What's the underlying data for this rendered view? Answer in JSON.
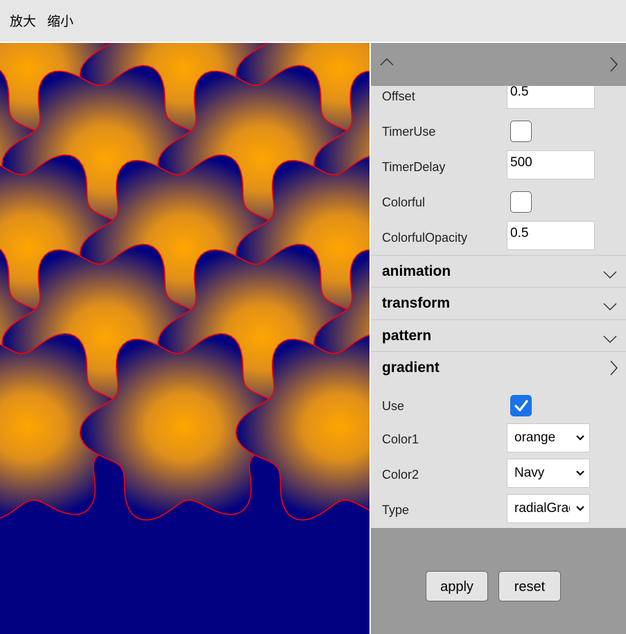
{
  "toolbar": {
    "zoom_in_label": "放大",
    "zoom_out_label": "缩小"
  },
  "canvas": {
    "pattern": "interlocking gear-like tiles",
    "gradient_color1": "orange",
    "gradient_color2": "Navy",
    "stroke_color": "#ff0000"
  },
  "panel": {
    "fields": [
      {
        "label": "Offset",
        "type": "text",
        "value": "0.5"
      },
      {
        "label": "TimerUse",
        "type": "checkbox",
        "checked": false
      },
      {
        "label": "TimerDelay",
        "type": "text",
        "value": "500"
      },
      {
        "label": "Colorful",
        "type": "checkbox",
        "checked": false
      },
      {
        "label": "ColorfulOpacity",
        "type": "text",
        "value": "0.5"
      }
    ],
    "sections": [
      {
        "title": "animation",
        "expanded": false
      },
      {
        "title": "transform",
        "expanded": false
      },
      {
        "title": "pattern",
        "expanded": false
      },
      {
        "title": "gradient",
        "expanded": true
      }
    ],
    "gradient_fields": [
      {
        "label": "Use",
        "type": "checkbox",
        "checked": true
      },
      {
        "label": "Color1",
        "type": "select",
        "value": "orange"
      },
      {
        "label": "Color2",
        "type": "select",
        "value": "Navy"
      },
      {
        "label": "Type",
        "type": "select",
        "value": "radialGradient"
      }
    ]
  },
  "footer": {
    "apply_label": "apply",
    "reset_label": "reset"
  },
  "colors": {
    "accent": "#1a73e8",
    "panel_bg": "#e0e0e0",
    "panel_head": "#9a9a9a",
    "toolbar_bg": "#e6e6e6"
  }
}
